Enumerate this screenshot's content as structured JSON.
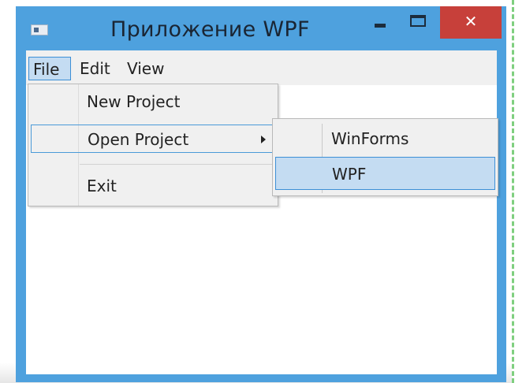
{
  "window": {
    "title": "Приложение WPF",
    "close_glyph": "✕",
    "accent_color": "#4ea1de",
    "close_color": "#c7403a"
  },
  "menubar": {
    "items": [
      {
        "label": "File",
        "open": true
      },
      {
        "label": "Edit",
        "open": false
      },
      {
        "label": "View",
        "open": false
      }
    ]
  },
  "file_menu": {
    "items": [
      {
        "label": "New Project"
      },
      {
        "label": "Open Project",
        "has_submenu": true,
        "highlighted": true
      },
      {
        "label": "Exit"
      }
    ]
  },
  "open_project_submenu": {
    "items": [
      {
        "label": "WinForms"
      },
      {
        "label": "WPF",
        "selected": true
      }
    ]
  },
  "icons": [
    "app-icon",
    "minimize-icon",
    "maximize-icon",
    "close-icon",
    "submenu-arrow-icon"
  ]
}
